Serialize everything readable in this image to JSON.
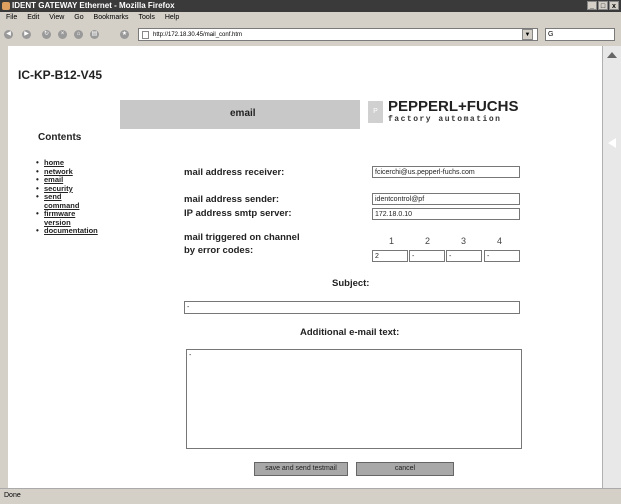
{
  "window": {
    "title": "IDENT GATEWAY Ethernet - Mozilla Firefox",
    "buttons": [
      "_",
      "□",
      "x"
    ]
  },
  "menu": [
    "File",
    "Edit",
    "View",
    "Go",
    "Bookmarks",
    "Tools",
    "Help"
  ],
  "toolbar": {
    "url": "http://172.18.30.45/mail_conf.htm",
    "go": "▼",
    "search_placeholder": "G"
  },
  "status": {
    "text": "Done"
  },
  "sidebar": {
    "device_name": "IC-KP-B12-V45",
    "contents_label": "Contents",
    "links": [
      "home",
      "network",
      "email",
      "security",
      "send command",
      "firmware version",
      "documentation"
    ]
  },
  "page": {
    "title": "email",
    "brand": "PEPPERL+FUCHS",
    "tagline": "factory automation",
    "form": {
      "receiver_label": "mail address receiver:",
      "receiver_value": "fcicerchi@us.pepperl-fuchs.com",
      "sender_label": "mail address sender:",
      "sender_value": "identcontrol@pf",
      "smtp_label": "IP address smtp server:",
      "smtp_value": "172.18.0.10",
      "trigger_label_1": "mail triggered on channel",
      "trigger_label_2": "by error codes:",
      "channels": [
        "1",
        "2",
        "3",
        "4"
      ],
      "channel_values": [
        "2",
        "-",
        "-",
        "-"
      ],
      "subject_label": "Subject:",
      "subject_value": "-",
      "additional_label": "Additional e-mail text:",
      "additional_value": "-",
      "save_button": "save and send testmail",
      "cancel_button": "cancel"
    }
  }
}
